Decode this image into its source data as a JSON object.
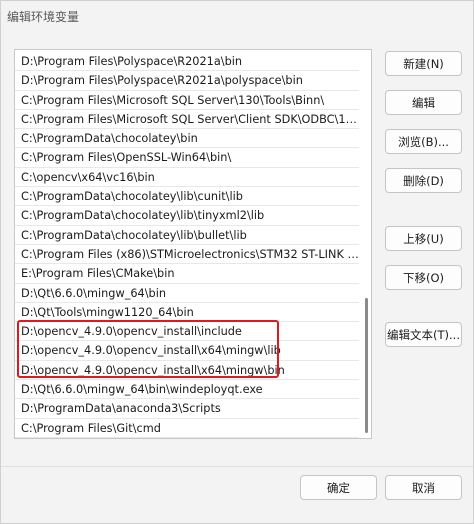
{
  "window": {
    "title": "编辑环境变量"
  },
  "paths": [
    "D:\\Program Files\\Polyspace\\R2021a\\bin",
    "D:\\Program Files\\Polyspace\\R2021a\\polyspace\\bin",
    "C:\\Program Files\\Microsoft SQL Server\\130\\Tools\\Binn\\",
    "C:\\Program Files\\Microsoft SQL Server\\Client SDK\\ODBC\\17...",
    "C:\\ProgramData\\chocolatey\\bin",
    "C:\\Program Files\\OpenSSL-Win64\\bin\\",
    "C:\\opencv\\x64\\vc16\\bin",
    "C:\\ProgramData\\chocolatey\\lib\\cunit\\lib",
    "C:\\ProgramData\\chocolatey\\lib\\tinyxml2\\lib",
    "C:\\ProgramData\\chocolatey\\lib\\bullet\\lib",
    "C:\\Program Files (x86)\\STMicroelectronics\\STM32 ST-LINK U...",
    "E:\\Program Files\\CMake\\bin",
    "D:\\Qt\\6.6.0\\mingw_64\\bin",
    "D:\\Qt\\Tools\\mingw1120_64\\bin",
    "D:\\opencv_4.9.0\\opencv_install\\include",
    "D:\\opencv_4.9.0\\opencv_install\\x64\\mingw\\lib",
    "D:\\opencv_4.9.0\\opencv_install\\x64\\mingw\\bin",
    "D:\\Qt\\6.6.0\\mingw_64\\bin\\windeployqt.exe",
    "D:\\ProgramData\\anaconda3\\Scripts",
    "C:\\Program Files\\Git\\cmd"
  ],
  "buttons": {
    "new": "新建(N)",
    "edit": "编辑",
    "browse": "浏览(B)...",
    "delete": "删除(D)",
    "move_up": "上移(U)",
    "move_down": "下移(O)",
    "edit_text": "编辑文本(T)...",
    "ok": "确定",
    "cancel": "取消"
  },
  "colors": {
    "highlight": "#e0191e",
    "background": "#f3f3f3"
  }
}
